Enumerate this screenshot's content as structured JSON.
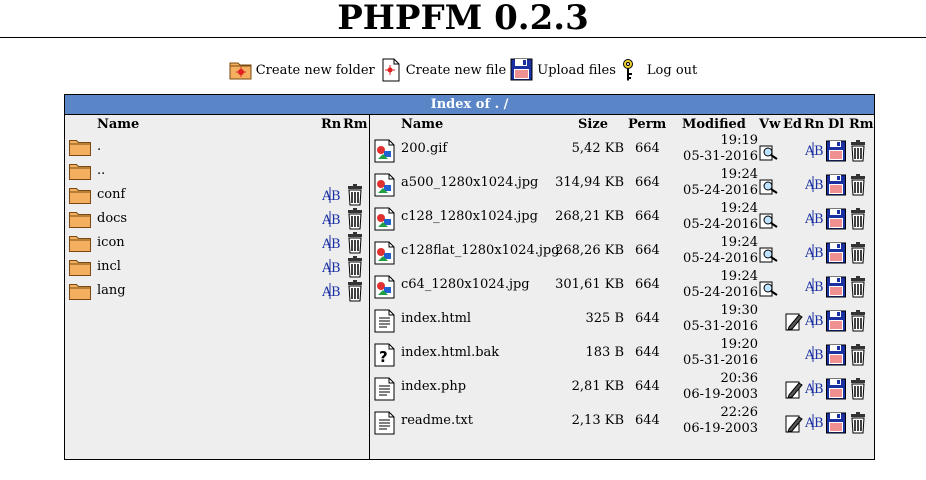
{
  "app_title": "PHPFM 0.2.3",
  "toolbar": {
    "create_folder": "Create new folder",
    "create_file": "Create new file",
    "upload": "Upload files",
    "logout": "Log out"
  },
  "index": {
    "label": "Index of",
    "path": ". /"
  },
  "dir_headers": {
    "name": "Name",
    "rn": "Rn",
    "rm": "Rm"
  },
  "dirs": [
    {
      "name": ".",
      "actions": false
    },
    {
      "name": "..",
      "actions": false
    },
    {
      "name": "conf",
      "actions": true
    },
    {
      "name": "docs",
      "actions": true
    },
    {
      "name": "icon",
      "actions": true
    },
    {
      "name": "incl",
      "actions": true
    },
    {
      "name": "lang",
      "actions": true
    }
  ],
  "file_headers": {
    "name": "Name",
    "size": "Size",
    "perm": "Perm",
    "modified": "Modified",
    "vw": "Vw",
    "ed": "Ed",
    "rn": "Rn",
    "dl": "Dl",
    "rm": "Rm"
  },
  "files": [
    {
      "name": "200.gif",
      "size": "5,42 KB",
      "perm": "664",
      "time": "19:19",
      "date": "05-31-2016",
      "type": "image",
      "view": true,
      "edit": false
    },
    {
      "name": "a500_1280x1024.jpg",
      "size": "314,94 KB",
      "perm": "664",
      "time": "19:24",
      "date": "05-24-2016",
      "type": "image",
      "view": true,
      "edit": false
    },
    {
      "name": "c128_1280x1024.jpg",
      "size": "268,21 KB",
      "perm": "664",
      "time": "19:24",
      "date": "05-24-2016",
      "type": "image",
      "view": true,
      "edit": false
    },
    {
      "name": "c128flat_1280x1024.jpg",
      "size": "268,26 KB",
      "perm": "664",
      "time": "19:24",
      "date": "05-24-2016",
      "type": "image",
      "view": true,
      "edit": false
    },
    {
      "name": "c64_1280x1024.jpg",
      "size": "301,61 KB",
      "perm": "664",
      "time": "19:24",
      "date": "05-24-2016",
      "type": "image",
      "view": true,
      "edit": false
    },
    {
      "name": "index.html",
      "size": "325 B",
      "perm": "644",
      "time": "19:30",
      "date": "05-31-2016",
      "type": "text",
      "view": false,
      "edit": true
    },
    {
      "name": "index.html.bak",
      "size": "183 B",
      "perm": "644",
      "time": "19:20",
      "date": "05-31-2016",
      "type": "unknown",
      "view": false,
      "edit": false
    },
    {
      "name": "index.php",
      "size": "2,81 KB",
      "perm": "644",
      "time": "20:36",
      "date": "06-19-2003",
      "type": "text",
      "view": false,
      "edit": true
    },
    {
      "name": "readme.txt",
      "size": "2,13 KB",
      "perm": "644",
      "time": "22:26",
      "date": "06-19-2003",
      "type": "text",
      "view": false,
      "edit": true
    }
  ],
  "colors": {
    "header_bar": "#5a86c8",
    "panel_bg": "#eeeeee"
  }
}
